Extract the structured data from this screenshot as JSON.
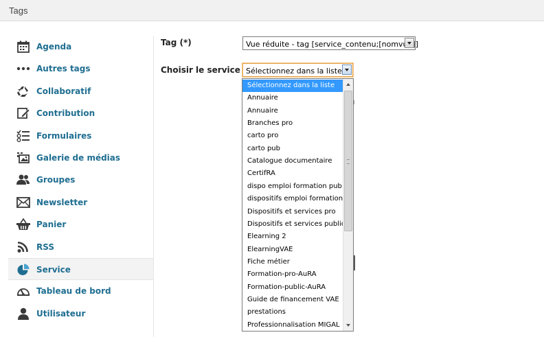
{
  "window": {
    "title": "Tags"
  },
  "sidebar": {
    "items": [
      {
        "label": "Agenda",
        "icon": "calendar-icon",
        "active": false
      },
      {
        "label": "Autres tags",
        "icon": "ellipsis-icon",
        "active": false
      },
      {
        "label": "Collaboratif",
        "icon": "recycle-arrows-icon",
        "active": false
      },
      {
        "label": "Contribution",
        "icon": "edit-pencil-icon",
        "active": false
      },
      {
        "label": "Formulaires",
        "icon": "checklist-icon",
        "active": false
      },
      {
        "label": "Galerie de médias",
        "icon": "image-gallery-icon",
        "active": false
      },
      {
        "label": "Groupes",
        "icon": "users-group-icon",
        "active": false
      },
      {
        "label": "Newsletter",
        "icon": "envelope-icon",
        "active": false
      },
      {
        "label": "Panier",
        "icon": "basket-icon",
        "active": false
      },
      {
        "label": "RSS",
        "icon": "rss-icon",
        "active": false
      },
      {
        "label": "Service",
        "icon": "pie-chart-icon",
        "active": true
      },
      {
        "label": "Tableau de bord",
        "icon": "gauge-icon",
        "active": false
      },
      {
        "label": "Utilisateur",
        "icon": "user-icon",
        "active": false
      }
    ]
  },
  "form": {
    "tag_label": "Tag (*)",
    "tag_value": "Vue réduite - tag [service_contenu;[nomvue]]",
    "service_label": "Choisir le service (*)",
    "service_value": "Sélectionnez dans la liste"
  },
  "dropdown": {
    "selected_index": 0,
    "options": [
      "Sélectionnez dans la liste",
      "Annuaire",
      "Annuaire",
      "Branches pro",
      "carto pro",
      "carto pub",
      "Catalogue documentaire",
      "CertifRA",
      "dispo emploi formation pub",
      "dispositifs emploi formation",
      "Dispositifs et services pro",
      "Dispositifs et services public",
      "Elearning 2",
      "ElearningVAE",
      "Fiche métier",
      "Formation-pro-AuRA",
      "Formation-public-AuRA",
      "Guide de financement VAE",
      "prestations",
      "Professionnalisation MIGAL"
    ]
  },
  "colors": {
    "link": "#1f6e91",
    "icon": "#3a3a3a",
    "selection": "#3399ff",
    "focus_border": "#e5a24a"
  }
}
